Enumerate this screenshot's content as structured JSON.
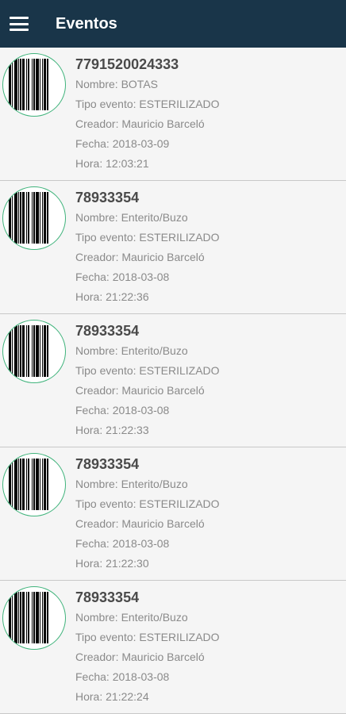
{
  "appbar": {
    "title": "Eventos",
    "menu_icon": "menu-icon",
    "background": "#193549"
  },
  "accent_color": "#3fb37b",
  "events": [
    {
      "code": "7791520024333",
      "nombre": "Nombre: BOTAS",
      "tipo": "Tipo evento: ESTERILIZADO",
      "creador": "Creador: Mauricio Barceló",
      "fecha": "Fecha: 2018-03-09",
      "hora": "Hora: 12:03:21",
      "icon": "barcode-icon"
    },
    {
      "code": "78933354",
      "nombre": "Nombre: Enterito/Buzo",
      "tipo": "Tipo evento: ESTERILIZADO",
      "creador": "Creador: Mauricio Barceló",
      "fecha": "Fecha: 2018-03-08",
      "hora": "Hora: 21:22:36",
      "icon": "barcode-icon"
    },
    {
      "code": "78933354",
      "nombre": "Nombre: Enterito/Buzo",
      "tipo": "Tipo evento: ESTERILIZADO",
      "creador": "Creador: Mauricio Barceló",
      "fecha": "Fecha: 2018-03-08",
      "hora": "Hora: 21:22:33",
      "icon": "barcode-icon"
    },
    {
      "code": "78933354",
      "nombre": "Nombre: Enterito/Buzo",
      "tipo": "Tipo evento: ESTERILIZADO",
      "creador": "Creador: Mauricio Barceló",
      "fecha": "Fecha: 2018-03-08",
      "hora": "Hora: 21:22:30",
      "icon": "barcode-icon"
    },
    {
      "code": "78933354",
      "nombre": "Nombre: Enterito/Buzo",
      "tipo": "Tipo evento: ESTERILIZADO",
      "creador": "Creador: Mauricio Barceló",
      "fecha": "Fecha: 2018-03-08",
      "hora": "Hora: 21:22:24",
      "icon": "barcode-icon"
    }
  ]
}
